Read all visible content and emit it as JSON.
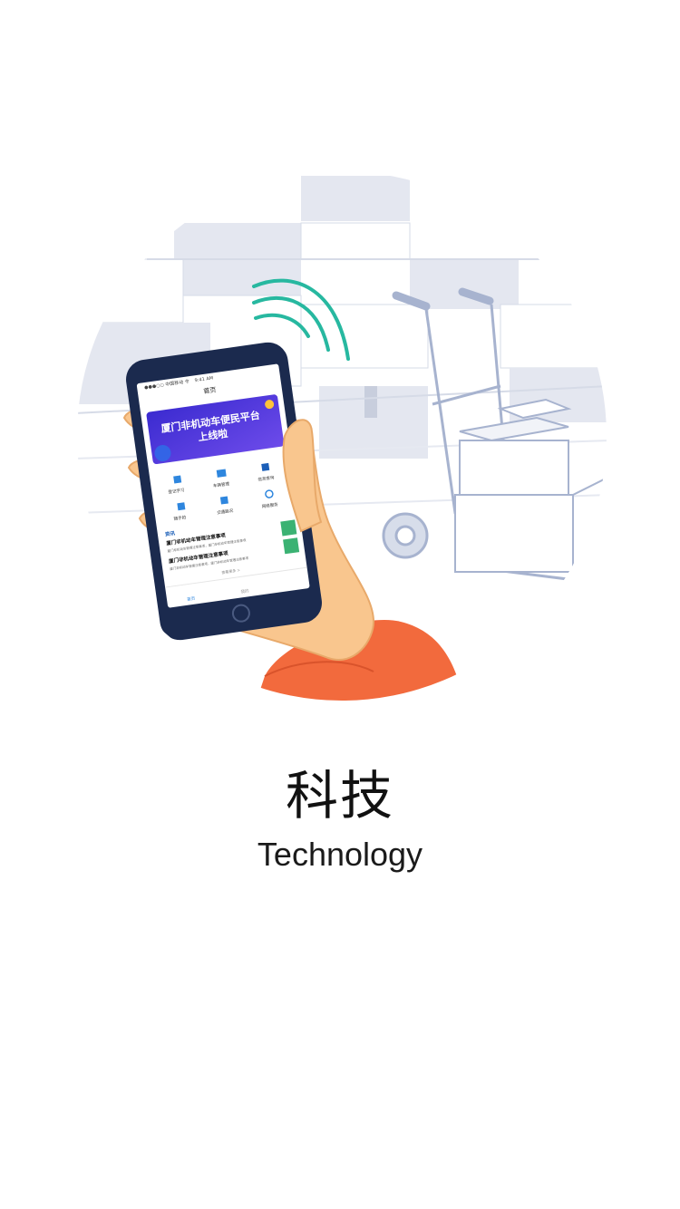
{
  "screen": {
    "title": "科技",
    "subtitle": "Technology"
  },
  "illustration": {
    "phone": {
      "status_carrier": "●●●○○ 中国移动 令",
      "status_time": "9:41 AM",
      "page_title": "首页",
      "banner_line1": "厦门非机动车便民平台",
      "banner_line2": "上线啦",
      "grid_items": [
        "登记学习",
        "车辆管理",
        "信息查询",
        "随手拍",
        "交通路况",
        "网络服务"
      ],
      "news_section_label": "资讯",
      "news_items": [
        {
          "title": "厦门非机动车管理注意事项",
          "desc": "厦门非机动车管理注意事项，厦门非机动车管理注意事项"
        },
        {
          "title": "厦门非机动车管理注意事项",
          "desc": "厦门非机动车管理注意事项，厦门非机动车管理注意事项"
        }
      ],
      "more_label": "查看更多 >",
      "tab_home": "首页",
      "tab_mine": "我的"
    },
    "colors": {
      "skin": "#F9C68E",
      "sleeve": "#F26A3D",
      "phone_body": "#1B2A4E",
      "wifi": "#27B8A0",
      "banner_start": "#4B2FD6",
      "banner_end": "#6E5CF0",
      "box_fill": "#EEF0F6",
      "line": "#A7B3CF"
    },
    "icons": [
      "wifi-signal-icon",
      "hand-truck-icon",
      "phone-icon"
    ]
  }
}
